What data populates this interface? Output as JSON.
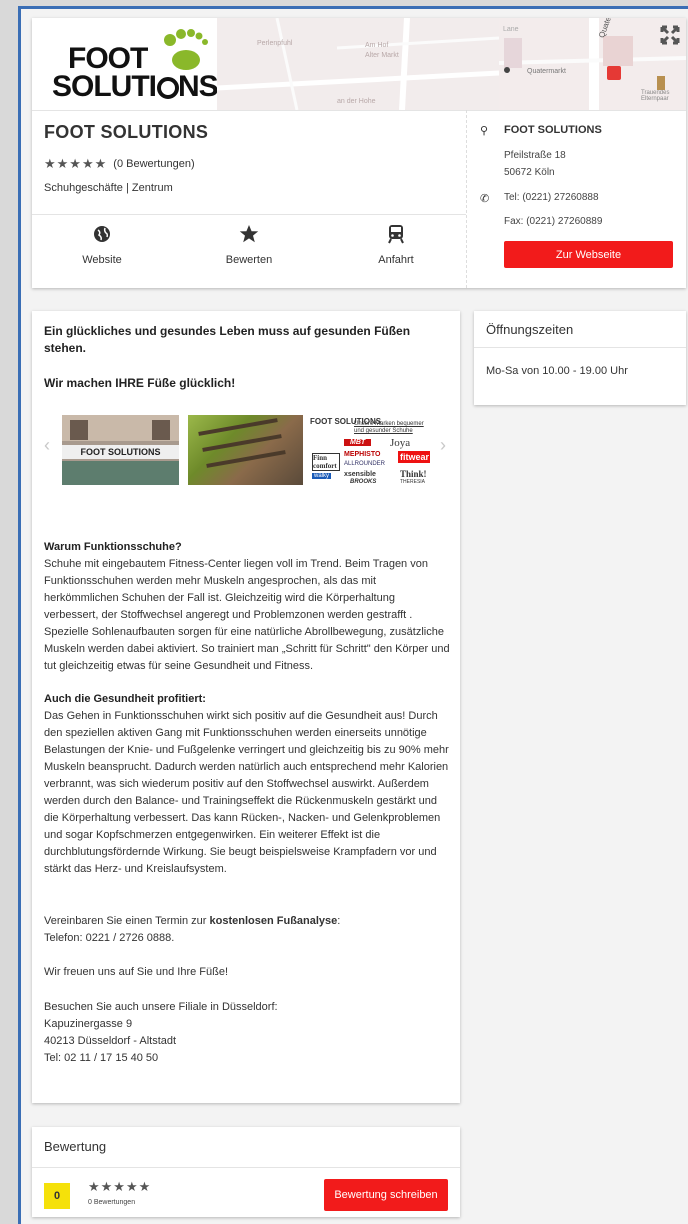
{
  "company": {
    "logo_text_top": "FOOT",
    "logo_text_bottom": "SOLUTI",
    "logo_text_end": "NS.",
    "name": "FOOT SOLUTIONS",
    "rating_count": "(0 Bewertungen)",
    "category": "Schuhgeschäfte | Zentrum"
  },
  "map": {
    "left_labels": [
      "Perlenpfuhl",
      "Am Hof",
      "Alter Markt",
      "an der Hohe"
    ],
    "right_labels": [
      "Quatermarkt",
      "Quatermarkt",
      "Trauendes Elternpaar",
      "Lane"
    ]
  },
  "actions": [
    {
      "label": "Website",
      "icon": "globe-icon"
    },
    {
      "label": "Bewerten",
      "icon": "star-icon"
    },
    {
      "label": "Anfahrt",
      "icon": "train-icon"
    }
  ],
  "contact": {
    "name": "FOOT SOLUTIONS",
    "street": "Pfeilstraße 18",
    "city": "50672 Köln",
    "phone": "Tel: (0221) 27260888",
    "fax": "Fax: (0221) 27260889",
    "website_button": "Zur Webseite"
  },
  "main": {
    "headline": "Ein glückliches und gesundes Leben muss auf gesunden Füßen stehen.",
    "subheadline": "Wir machen IHRE Füße glücklich!",
    "gallery": {
      "shop_sign": "FOOT SOLUTIONS",
      "brands_title": "Unsere Marken bequemer und gesunder Schuhe",
      "brands": [
        "FOOT SOLUTIONS",
        "MBT",
        "Joya",
        "Finn comfort",
        "MEPHISTO",
        "fitwear",
        "ALLROUNDER",
        "xsensible",
        "Think!",
        "walky",
        "BROOKS",
        "THERESIA"
      ]
    },
    "section1_title": "Warum Funktionsschuhe?",
    "section1_text": "Schuhe mit eingebautem Fitness-Center liegen voll im Trend. Beim Tragen von Funktionsschuhen werden mehr Muskeln angesprochen, als das mit herkömmlichen Schuhen der Fall ist. Gleichzeitig wird die Körperhaltung verbessert, der Stoffwechsel angeregt und Problemzonen werden gestrafft . Spezielle Sohlenaufbauten sorgen für eine natürliche Abrollbewegung, zusätzliche Muskeln werden dabei aktiviert. So trainiert man „Schritt für Schritt\" den Körper und tut gleichzeitig etwas für seine Gesundheit und Fitness.",
    "section2_title": "Auch die Gesundheit profitiert:",
    "section2_text": "Das Gehen in Funktionsschuhen wirkt sich positiv auf die Gesundheit aus! Durch den speziellen aktiven Gang mit Funktionsschuhen werden einerseits unnötige Belastungen der Knie- und Fußgelenke verringert und gleichzeitig bis zu 90% mehr Muskeln beansprucht. Dadurch werden natürlich auch entsprechend mehr Kalorien verbrannt, was sich wiederum positiv auf den Stoffwechsel auswirkt. Außerdem werden durch den Balance- und Trainingseffekt die Rückenmuskeln gestärkt und die Körperhaltung verbessert. Das kann Rücken-, Nacken- und Gelenkproblemen und sogar Kopfschmerzen entgegenwirken. Ein weiterer Effekt ist die durchblutungsfördernde Wirkung. Sie beugt beispielsweise Krampfadern vor und stärkt das Herz- und Kreislaufsystem.",
    "appointment_prefix": "Vereinbaren Sie einen Termin zur ",
    "appointment_bold": "kostenlosen Fußanalyse",
    "appointment_suffix": ":",
    "appointment_phone": "Telefon: 0221 / 2726 0888.",
    "closing": "Wir freuen uns auf Sie und Ihre Füße!",
    "branch_intro": "Besuchen Sie auch unsere Filiale in Düsseldorf:",
    "branch_street": "Kapuzinergasse 9",
    "branch_city": "40213 Düsseldorf - Altstadt",
    "branch_phone": "Tel: 02 11 / 17 15 40 50"
  },
  "hours": {
    "title": "Öffnungszeiten",
    "text": "Mo-Sa von 10.00 - 19.00 Uhr"
  },
  "rating": {
    "title": "Bewertung",
    "score": "0",
    "count": "0 Bewertungen",
    "write_button": "Bewertung schreiben"
  },
  "colors": {
    "accent_red": "#f21b1b",
    "score_yellow": "#f5e10a",
    "frame_blue": "#3a6eb5"
  }
}
